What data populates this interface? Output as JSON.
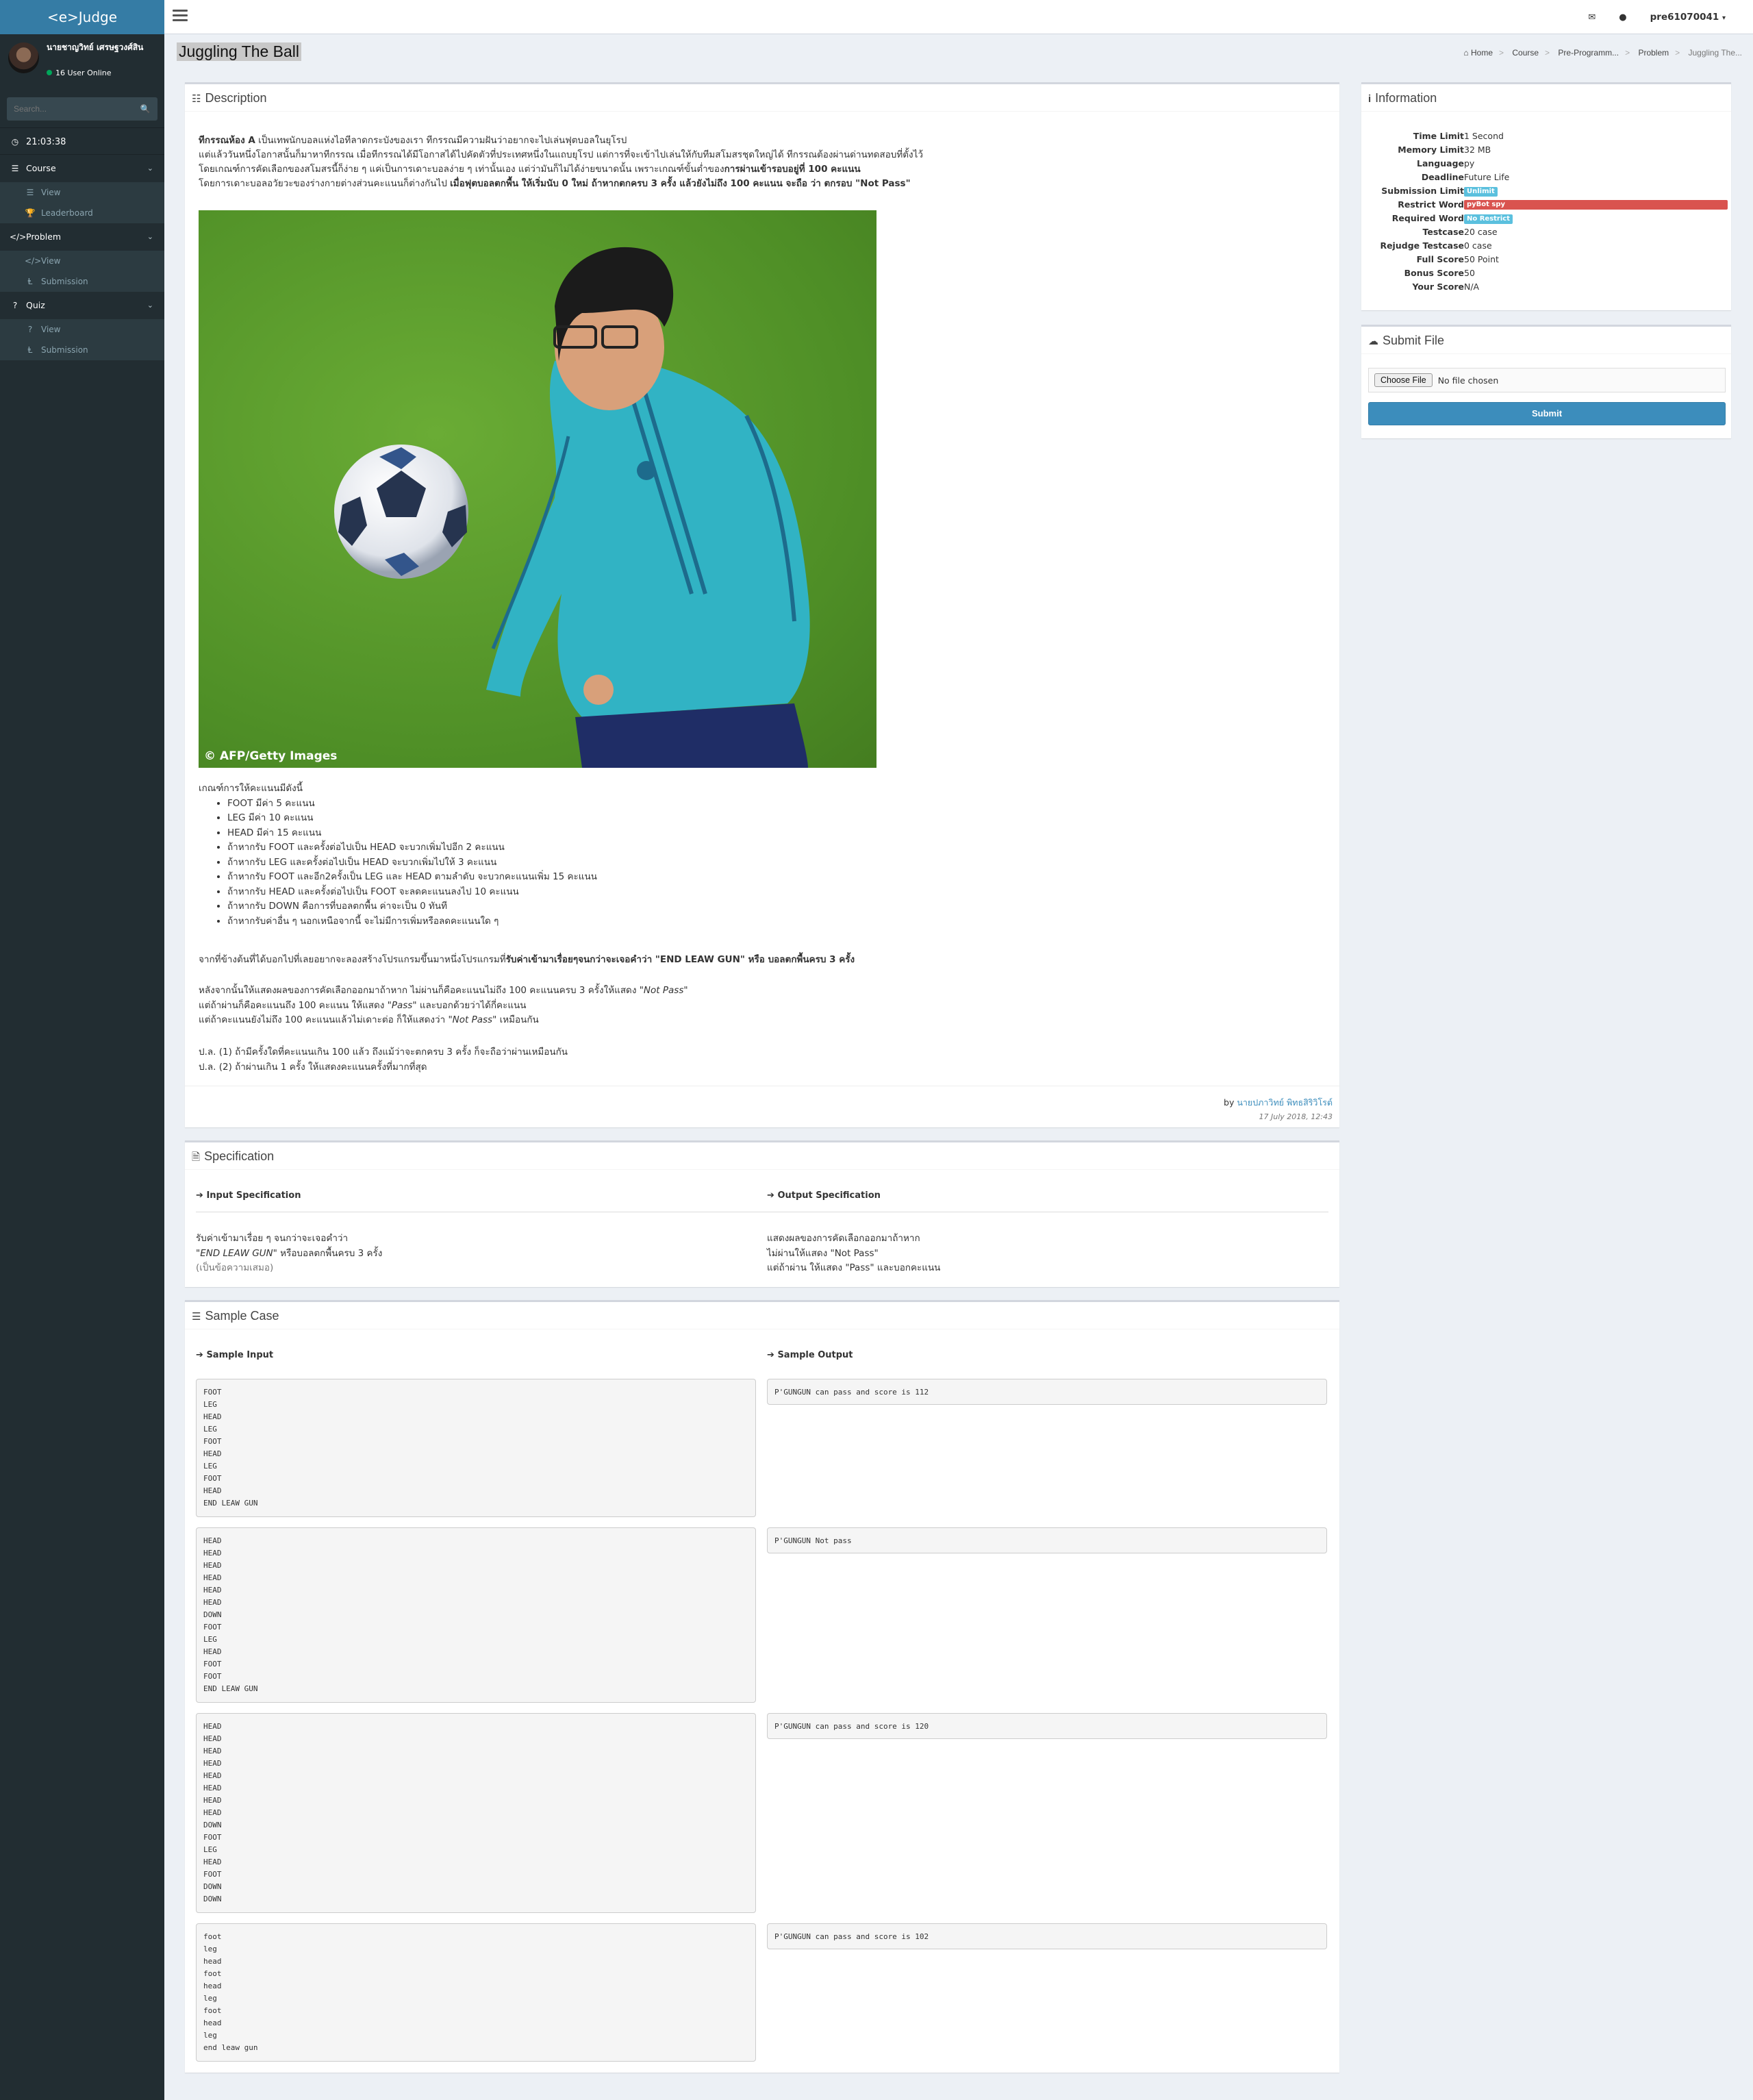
{
  "app": {
    "brand": "<e>Judge"
  },
  "user": {
    "name": "นายชาญวิทย์ เศรษฐวงศ์สิน",
    "online": "16 User Online"
  },
  "search": {
    "placeholder": "Search..."
  },
  "clock": "21:03:38",
  "sidebar": {
    "course": {
      "label": "Course",
      "items": [
        "View",
        "Leaderboard"
      ]
    },
    "problem": {
      "label": "Problem",
      "items": [
        "View",
        "Submission"
      ]
    },
    "quiz": {
      "label": "Quiz",
      "items": [
        "View",
        "Submission"
      ]
    }
  },
  "topbar": {
    "account": "pre61070041"
  },
  "page": {
    "title": "Juggling The Ball"
  },
  "breadcrumb": [
    "Home",
    "Course",
    "Pre-Programm...",
    "Problem",
    "Juggling The..."
  ],
  "description": {
    "header": "Description",
    "intro_bold": "ทีกรรณห้อง A",
    "intro_line1": " เป็นเทพนักบอลแห่งไอทีลาดกระบังของเรา ทีกรรณมีความฝันว่าอยากจะไปเล่นฟุตบอลในยุโรป",
    "intro_line2": "แต่แล้ววันหนึ่งโอกาสนั้นก็มาหาทีกรรณ เมื่อทีกรรณได้มีโอกาสได้ไปคัดตัวที่ประเทศหนึ่งในแถบยุโรป แต่การที่จะเข้าไปเล่นให้กับทีมสโมสรชุดใหญ่ได้ ทีกรรณต้องผ่านด่านทดสอบที่ตั้งไว้",
    "intro_line3a": "โดยเกณฑ์การคัดเลือกของสโมสรนี้ก็ง่าย ๆ แค่เป็นการเดาะบอลง่าย ๆ เท่านั้นเอง แต่ว่ามันก็ไม่ได้ง่ายขนาดนั้น เพราะเกณฑ์ขั้นต่ำของ",
    "intro_line3b": "การผ่านเข้ารอบอยู่ที่ 100 คะแนน",
    "intro_line4a": "โดยการเดาะบอลอวัยวะของร่างกายต่างส่วนคะแนนก็ต่างกันไป ",
    "intro_line4b": "เมื่อฟุตบอลตกพื้น ให้เริ่มนับ 0 ใหม่ ถ้าหากตกครบ 3 ครั้ง แล้วยังไม่ถึง 100 คะแนน จะถือ ว่า ตกรอบ \"Not Pass\"",
    "photo_credit": "© AFP/Getty Images",
    "criteria_title": "เกณฑ์การให้คะแนนมีดังนี้",
    "criteria": [
      "FOOT มีค่า 5 คะแนน",
      "LEG มีค่า 10 คะแนน",
      "HEAD มีค่า 15 คะแนน",
      "ถ้าหากรับ FOOT และครั้งต่อไปเป็น HEAD จะบวกเพิ่มไปอีก 2 คะแนน",
      "ถ้าหากรับ LEG และครั้งต่อไปเป็น HEAD จะบวกเพิ่มไปให้ 3 คะแนน",
      "ถ้าหากรับ FOOT และอีก2ครั้งเป็น LEG และ HEAD ตามลำดับ จะบวกคะแนนเพิ่ม 15 คะแนน",
      "ถ้าหากรับ HEAD และครั้งต่อไปเป็น FOOT จะลดคะแนนลงไป 10 คะแนน",
      "ถ้าหากรับ DOWN คือการที่บอลตกพื้น ค่าจะเป็น 0 ทันที",
      "ถ้าหากรับค่าอื่น ๆ นอกเหนือจากนี้ จะไม่มีการเพิ่มหรือลดคะแนนใด ๆ"
    ],
    "task_a": "จากที่ข้างต้นที่ได้บอกไปที่เลยอยากจะลองสร้างโปรแกรมขึ้นมาหนึ่งโปรแกรมที่",
    "task_b": "รับค่าเข้ามาเรื่อยๆจนกว่าจะเจอคำว่า \"END LEAW GUN\" หรือ บอลตกพื้นครบ 3 ครั้ง",
    "out_line1a": "หลังจากนั้นให้แสดงผลของการคัดเลือกออกมาถ้าหาก ไม่ผ่านก็คือคะแนนไม่ถึง 100 คะแนนครบ 3 ครั้งให้แสดง ",
    "out_line1b": "\"Not Pass\"",
    "out_line2a": "แต่ถ้าผ่านก็คือคะแนนถึง 100 คะแนน ให้แสดง ",
    "out_line2b": "\"Pass\"",
    "out_line2c": " และบอกด้วยว่าได้กี่คะแนน",
    "out_line3a": "แต่ถ้าคะแนนยังไม่ถึง 100 คะแนนแล้วไม่เดาะต่อ ก็ให้แสดงว่า ",
    "out_line3b": "\"Not Pass\"",
    "out_line3c": " เหมือนกัน",
    "ps1": "ป.ล. (1) ถ้ามีครั้งใดที่คะแนนเกิน 100 แล้ว ถึงแม้ว่าจะตกครบ 3 ครั้ง ก็จะถือว่าผ่านเหมือนกัน",
    "ps2": "ป.ล. (2) ถ้าผ่านเกิน 1 ครั้ง ให้แสดงคะแนนครั้งที่มากที่สุด",
    "by": "by ",
    "author": "นายปภาวิทย์ พิทธสิริวิโรต์",
    "date": "17 July 2018, 12:43"
  },
  "specification": {
    "header": "Specification",
    "input_title": "Input Specification",
    "output_title": "Output Specification",
    "input_line1": "รับค่าเข้ามาเรื่อย ๆ จนกว่าจะเจอคำว่า",
    "input_line2a": "\"END LEAW GUN\"",
    "input_line2b": " หรือบอลตกพื้นครบ 3 ครั้ง",
    "input_line3": "(เป็นข้อความเสมอ)",
    "output_line1": "แสดงผลของการคัดเลือกออกมาถ้าหาก",
    "output_line2": "ไม่ผ่านให้แสดง \"Not Pass\"",
    "output_line3": "แต่ถ้าผ่าน ให้แสดง \"Pass\" และบอกคะแนน"
  },
  "sample": {
    "header": "Sample Case",
    "input_title": "Sample Input",
    "output_title": "Sample Output",
    "cases": [
      {
        "input": "FOOT\nLEG\nHEAD\nLEG\nFOOT\nHEAD\nLEG\nFOOT\nHEAD\nEND LEAW GUN",
        "output": "P'GUNGUN can pass and score is 112"
      },
      {
        "input": "HEAD\nHEAD\nHEAD\nHEAD\nHEAD\nHEAD\nDOWN\nFOOT\nLEG\nHEAD\nFOOT\nFOOT\nEND LEAW GUN",
        "output": "P'GUNGUN Not pass"
      },
      {
        "input": "HEAD\nHEAD\nHEAD\nHEAD\nHEAD\nHEAD\nHEAD\nHEAD\nDOWN\nFOOT\nLEG\nHEAD\nFOOT\nDOWN\nDOWN",
        "output": "P'GUNGUN can pass and score is 120"
      },
      {
        "input": "foot\nleg\nhead\nfoot\nhead\nleg\nfoot\nhead\nleg\nend leaw gun",
        "output": "P'GUNGUN can pass and score is 102"
      }
    ]
  },
  "information": {
    "header": "Information",
    "rows": [
      {
        "k": "Time Limit",
        "v": "1 Second"
      },
      {
        "k": "Memory Limit",
        "v": "32 MB"
      },
      {
        "k": "Language",
        "v": "py"
      },
      {
        "k": "Deadline",
        "v": "Future Life"
      },
      {
        "k": "Submission Limit",
        "v": "Unlimit"
      },
      {
        "k": "Restrict Word",
        "v": "pyBot spy"
      },
      {
        "k": "Required Word",
        "v": "No Restrict"
      },
      {
        "k": "Testcase",
        "v": "20 case"
      },
      {
        "k": "Rejudge Testcase",
        "v": "0 case"
      },
      {
        "k": "Full Score",
        "v": "50 Point"
      },
      {
        "k": "Bonus Score",
        "v": "50"
      },
      {
        "k": "Your Score",
        "v": "N/A"
      }
    ]
  },
  "submit": {
    "header": "Submit File",
    "choose_label": "Choose File",
    "no_file": "No file chosen",
    "submit_label": "Submit"
  },
  "colors": {
    "sidebar": "#222d32",
    "accent": "#3c8dbc",
    "danger": "#d9534f",
    "info": "#5bc0de"
  }
}
